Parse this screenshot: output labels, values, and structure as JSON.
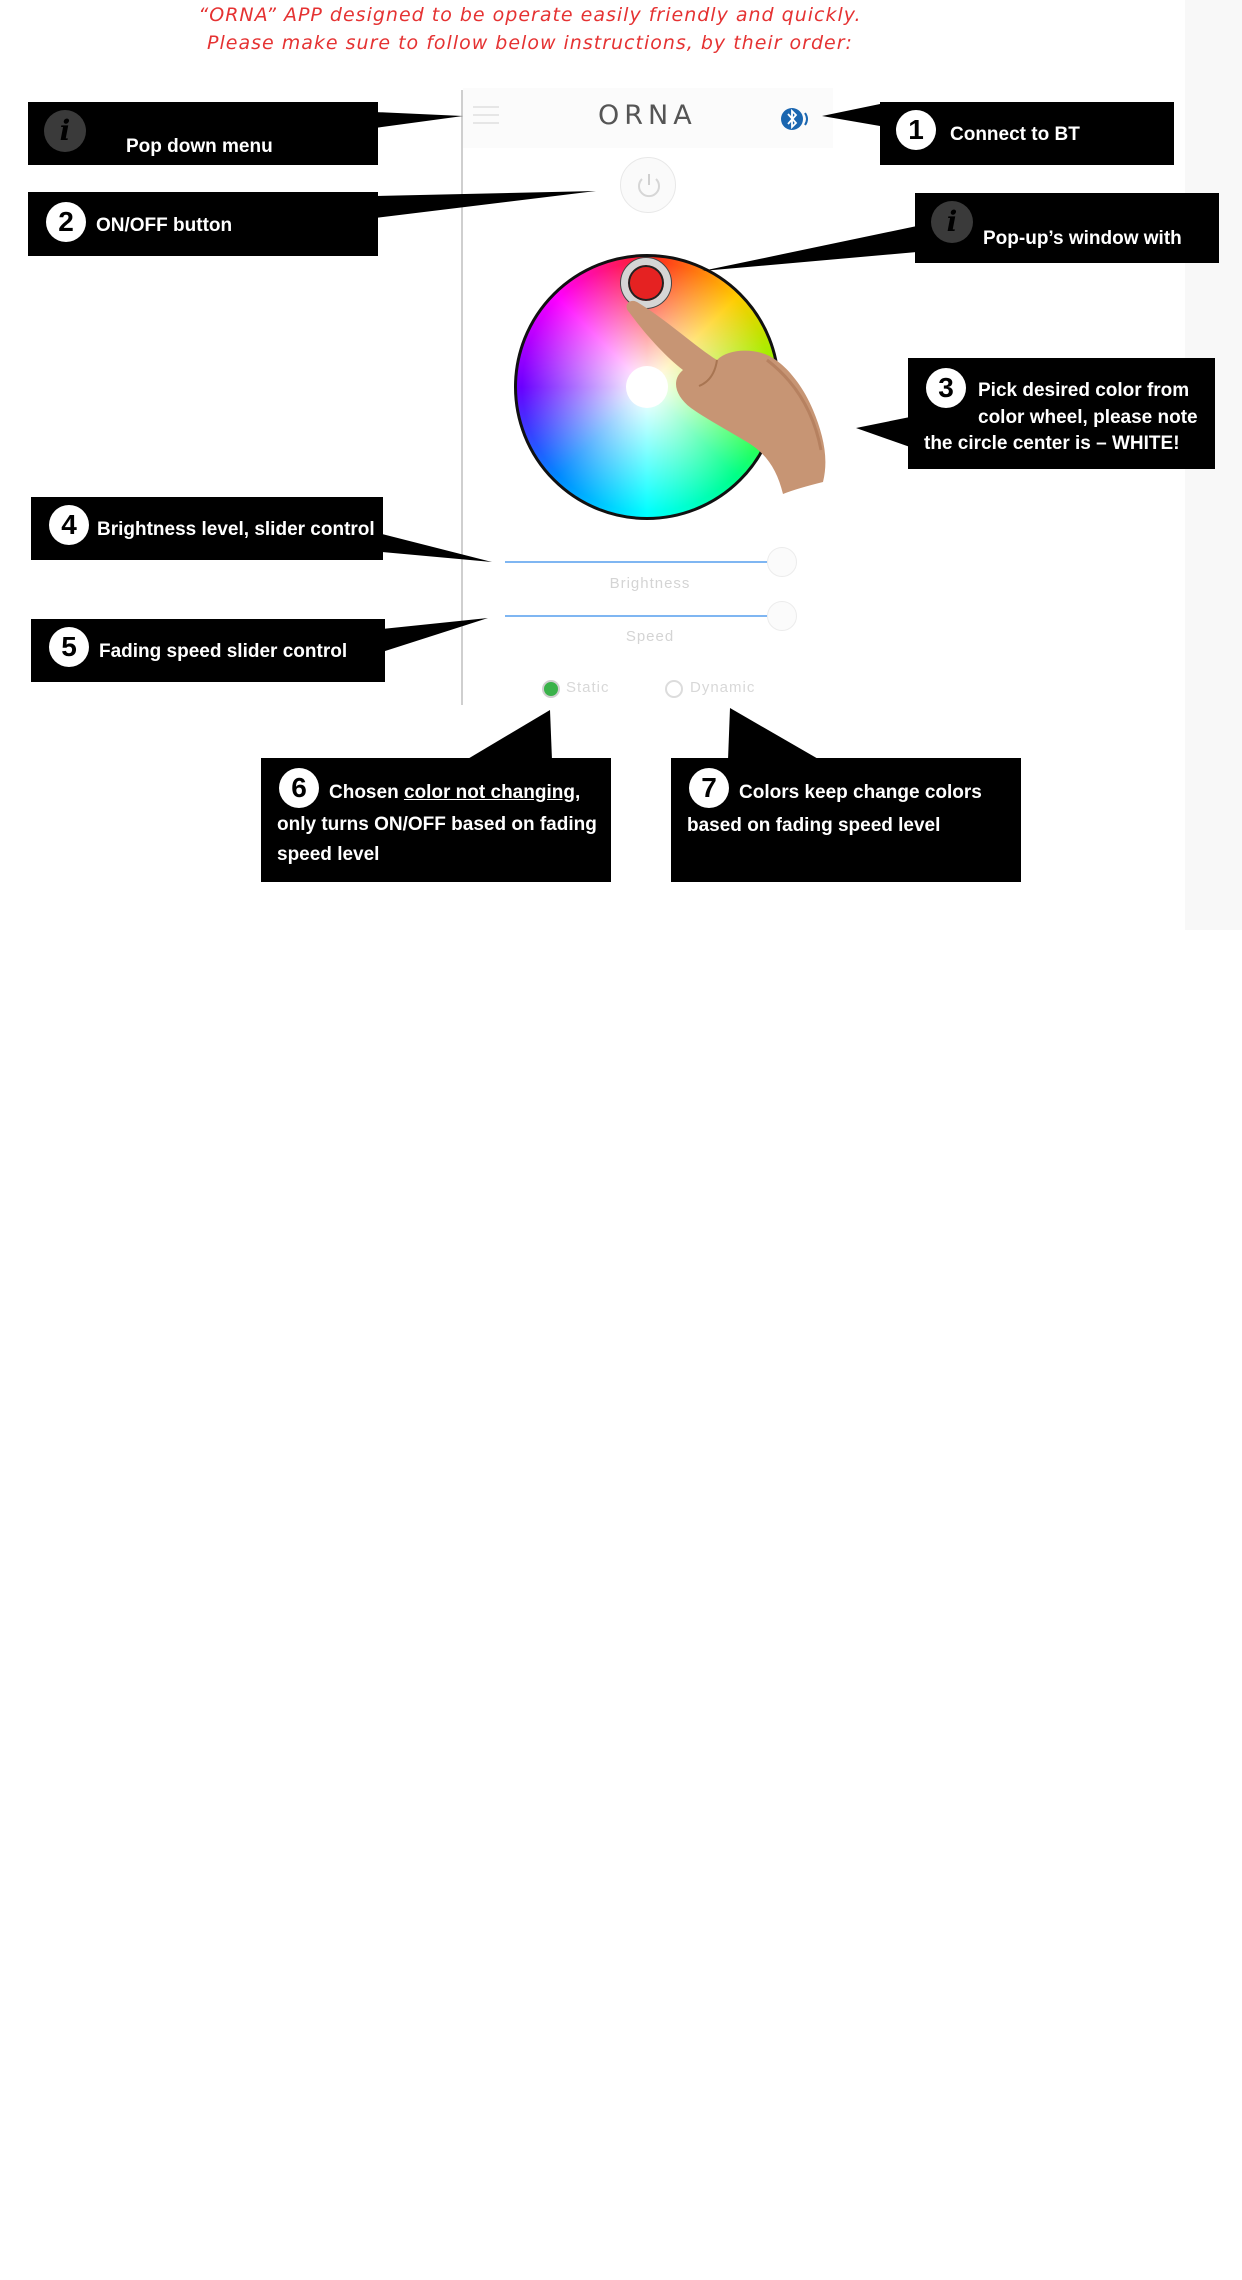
{
  "intro": {
    "line1": "“ORNA” APP designed to be operate easily friendly and quickly.",
    "line2": "Please make sure to follow below instructions, by their order:"
  },
  "app": {
    "logo": "ORNA",
    "sliders": {
      "brightness_label": "Brightness",
      "speed_label": "Speed"
    },
    "modes": {
      "static_label": "Static",
      "dynamic_label": "Dynamic",
      "selected": "Static"
    },
    "colors": {
      "selected_color": "#e52222",
      "accent": "#7fb6f2",
      "bluetooth": "#1a66b0",
      "radio_on": "#3ab24a"
    }
  },
  "callouts": {
    "menu": {
      "icon": "info-icon",
      "text": "Pop down menu"
    },
    "connect": {
      "number": "1",
      "text": "Connect to BT"
    },
    "onoff": {
      "number": "2",
      "text": "ON/OFF button"
    },
    "popup": {
      "icon": "info-icon",
      "text": "Pop-up’s window with"
    },
    "color": {
      "number": "3",
      "line1": "Pick desired color from",
      "line2": "color wheel, please note",
      "line3": "the circle center is – WHITE!"
    },
    "brightness": {
      "number": "4",
      "text": "Brightness level, slider control"
    },
    "speed": {
      "number": "5",
      "text": "Fading speed slider control"
    },
    "static": {
      "number": "6",
      "pre": "Chosen ",
      "underlined": "color not changing",
      "post": ",",
      "line2": "only turns ON/OFF based on fading",
      "line3": "speed level"
    },
    "dynamic": {
      "number": "7",
      "line1": "Colors keep change colors",
      "line2": "based on fading speed level"
    }
  }
}
